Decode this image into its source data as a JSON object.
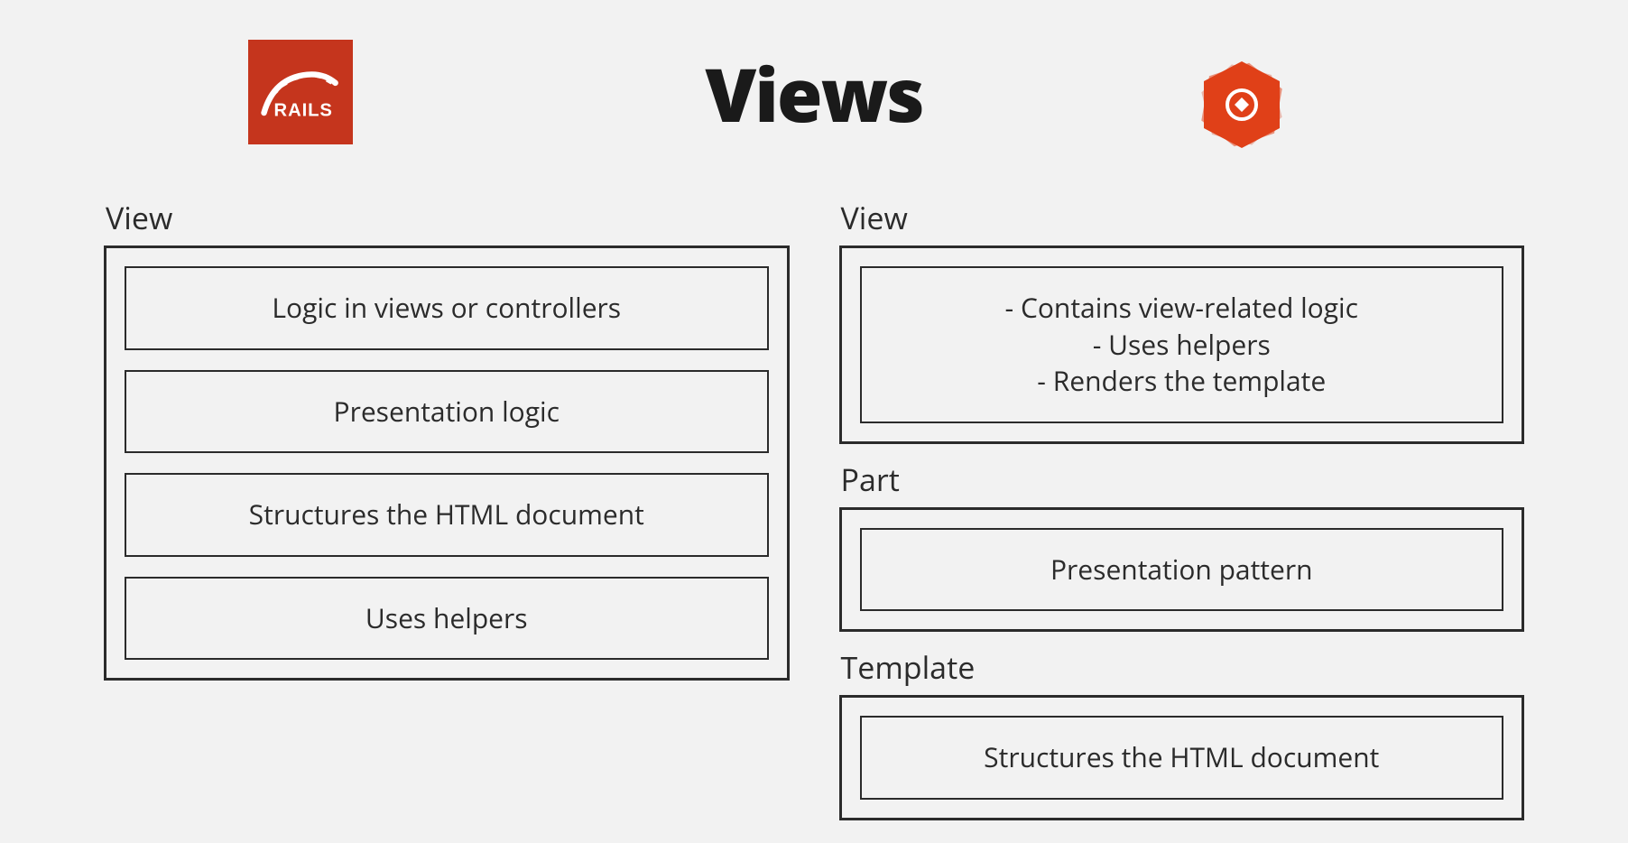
{
  "title": "Views",
  "logos": {
    "rails_name": "rails-logo-icon",
    "hanami_name": "hanami-logo-icon"
  },
  "left": {
    "sections": [
      {
        "label": "View",
        "boxes": [
          {
            "text": "Logic in views or controllers"
          },
          {
            "text": "Presentation logic"
          },
          {
            "text": "Structures the HTML document"
          },
          {
            "text": "Uses helpers"
          }
        ]
      }
    ]
  },
  "right": {
    "sections": [
      {
        "label": "View",
        "boxes": [
          {
            "lines": [
              "- Contains view-related logic",
              "- Uses helpers",
              "- Renders the template"
            ]
          }
        ]
      },
      {
        "label": "Part",
        "boxes": [
          {
            "text": "Presentation pattern"
          }
        ]
      },
      {
        "label": "Template",
        "boxes": [
          {
            "text": "Structures the HTML document"
          }
        ]
      }
    ]
  }
}
